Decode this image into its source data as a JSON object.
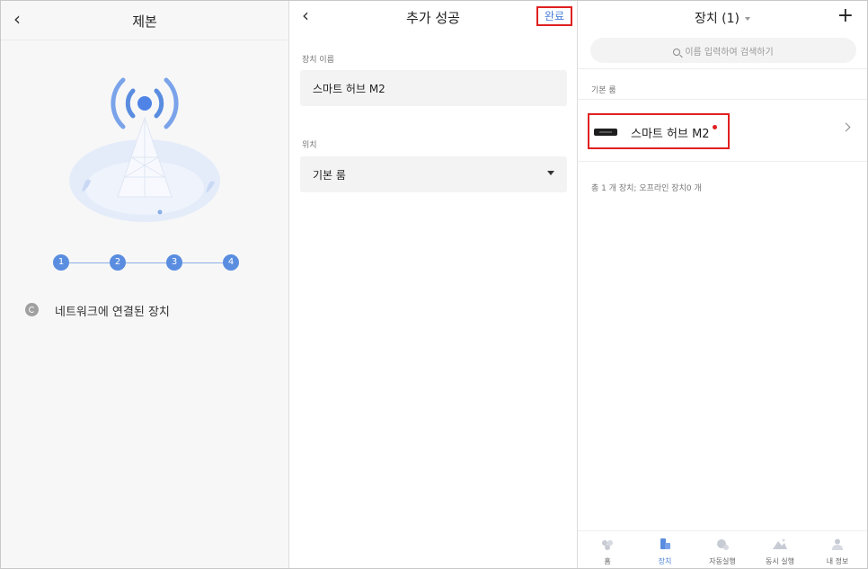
{
  "colors": {
    "accent": "#4a7fd8",
    "highlight": "#e02020",
    "step": "#5a8de0"
  },
  "panel1": {
    "title": "제본",
    "steps": [
      "1",
      "2",
      "3",
      "4"
    ],
    "status": "네트워크에 연결된 장치"
  },
  "panel2": {
    "title": "추가 성공",
    "done_label": "완료",
    "name_label": "장치 이름",
    "name_value": "스마트 허브 M2",
    "location_label": "위치",
    "location_value": "기본 룸"
  },
  "panel3": {
    "title": "장치 (1)",
    "search_placeholder": "이름 입력하여 검색하기",
    "room_label": "기본 룸",
    "device_name": "스마트 허브 M2",
    "total_text": "총 1 개 장치; 오프라인 장치0 개",
    "tabs": [
      {
        "label": "홈",
        "icon": "home-icon"
      },
      {
        "label": "장치",
        "icon": "device-icon"
      },
      {
        "label": "자동실행",
        "icon": "automation-icon"
      },
      {
        "label": "동시 실행",
        "icon": "scene-icon"
      },
      {
        "label": "내 정보",
        "icon": "profile-icon"
      }
    ]
  }
}
